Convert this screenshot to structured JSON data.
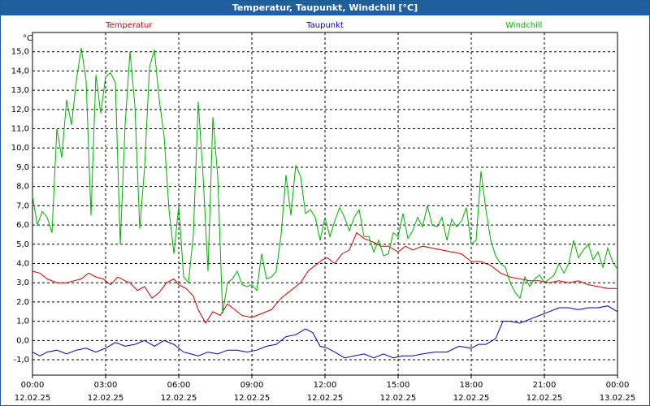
{
  "window": {
    "title": "Temperatur, Taupunkt, Windchill [°C]"
  },
  "chart_data": {
    "type": "line",
    "title": "Temperatur, Taupunkt, Windchill [°C]",
    "ylabel": "°C",
    "ylim": [
      -1.8,
      16.0
    ],
    "xlim": [
      0,
      24
    ],
    "y_ticks": [
      -1.0,
      0.0,
      1.0,
      2.0,
      3.0,
      4.0,
      5.0,
      6.0,
      7.0,
      8.0,
      9.0,
      10.0,
      11.0,
      12.0,
      13.0,
      14.0,
      15.0
    ],
    "y_tick_labels": [
      "-1,0",
      "0,0",
      "1,0",
      "2,0",
      "3,0",
      "4,0",
      "5,0",
      "6,0",
      "7,0",
      "8,0",
      "9,0",
      "10,0",
      "11,0",
      "12,0",
      "13,0",
      "14,0",
      "15,0"
    ],
    "x_ticks": [
      {
        "value": 0,
        "time": "00:00",
        "date": "12.02.25"
      },
      {
        "value": 3,
        "time": "03:00",
        "date": "12.02.25"
      },
      {
        "value": 6,
        "time": "06:00",
        "date": "12.02.25"
      },
      {
        "value": 9,
        "time": "09:00",
        "date": "12.02.25"
      },
      {
        "value": 12,
        "time": "12:00",
        "date": "12.02.25"
      },
      {
        "value": 15,
        "time": "15:00",
        "date": "12.02.25"
      },
      {
        "value": 18,
        "time": "18:00",
        "date": "12.02.25"
      },
      {
        "value": 21,
        "time": "21:00",
        "date": "12.02.25"
      },
      {
        "value": 24,
        "time": "00:00",
        "date": "13.02.25"
      }
    ],
    "grid": true,
    "legend": "top",
    "series": [
      {
        "name": "Temperatur",
        "color": "#d00000",
        "x": [
          0,
          0.3,
          0.6,
          1.0,
          1.4,
          1.7,
          2.0,
          2.3,
          2.6,
          2.9,
          3.2,
          3.5,
          3.8,
          4.0,
          4.3,
          4.6,
          4.9,
          5.2,
          5.5,
          5.8,
          6.0,
          6.3,
          6.6,
          6.8,
          7.1,
          7.4,
          7.7,
          8.0,
          8.3,
          8.6,
          9.0,
          9.4,
          9.8,
          10.2,
          10.6,
          11.0,
          11.3,
          11.6,
          11.9,
          12.1,
          12.4,
          12.7,
          13.0,
          13.3,
          13.6,
          14.0,
          14.3,
          14.6,
          15.0,
          15.3,
          15.6,
          16.0,
          16.4,
          16.8,
          17.2,
          17.6,
          18.0,
          18.4,
          18.8,
          19.2,
          19.6,
          20.0,
          20.4,
          20.8,
          21.2,
          21.6,
          22.0,
          22.4,
          22.8,
          23.2,
          23.6,
          24.0
        ],
        "y": [
          3.6,
          3.5,
          3.2,
          3.0,
          3.0,
          3.1,
          3.2,
          3.5,
          3.3,
          3.2,
          2.9,
          3.3,
          3.1,
          3.0,
          2.6,
          2.8,
          2.2,
          2.5,
          3.0,
          3.2,
          2.9,
          2.7,
          2.3,
          1.6,
          0.9,
          1.5,
          1.3,
          1.9,
          1.6,
          1.3,
          1.2,
          1.4,
          1.6,
          2.2,
          2.6,
          3.0,
          3.6,
          3.9,
          4.2,
          4.3,
          4.0,
          4.5,
          4.7,
          5.6,
          5.3,
          5.1,
          4.9,
          4.9,
          4.6,
          4.9,
          4.7,
          4.9,
          4.8,
          4.7,
          4.6,
          4.5,
          4.1,
          4.1,
          3.9,
          3.5,
          3.3,
          3.2,
          3.1,
          3.1,
          3.0,
          3.1,
          3.0,
          3.1,
          2.9,
          2.8,
          2.7,
          2.7
        ]
      },
      {
        "name": "Taupunkt",
        "color": "#0000c0",
        "x": [
          0,
          0.3,
          0.6,
          1.0,
          1.4,
          1.8,
          2.2,
          2.6,
          3.0,
          3.4,
          3.8,
          4.2,
          4.6,
          5.0,
          5.4,
          5.8,
          6.2,
          6.5,
          6.8,
          7.2,
          7.6,
          8.0,
          8.4,
          8.8,
          9.2,
          9.6,
          10.0,
          10.4,
          10.8,
          11.2,
          11.5,
          11.8,
          12.1,
          12.4,
          12.8,
          13.2,
          13.6,
          14.0,
          14.4,
          14.8,
          15.2,
          15.6,
          16.0,
          16.5,
          17.0,
          17.5,
          18.0,
          18.3,
          18.6,
          19.0,
          19.3,
          19.6,
          20.0,
          20.4,
          20.8,
          21.2,
          21.6,
          22.0,
          22.4,
          22.8,
          23.2,
          23.6,
          24.0
        ],
        "y": [
          -0.6,
          -0.8,
          -0.6,
          -0.5,
          -0.7,
          -0.5,
          -0.4,
          -0.6,
          -0.4,
          -0.1,
          -0.3,
          -0.2,
          0.0,
          -0.3,
          0.0,
          -0.2,
          -0.6,
          -0.7,
          -0.8,
          -0.6,
          -0.7,
          -0.5,
          -0.5,
          -0.6,
          -0.5,
          -0.3,
          -0.2,
          0.2,
          0.3,
          0.6,
          0.4,
          -0.3,
          -0.4,
          -0.6,
          -0.9,
          -0.8,
          -0.7,
          -0.9,
          -0.7,
          -0.9,
          -0.8,
          -0.8,
          -0.7,
          -0.6,
          -0.6,
          -0.3,
          -0.4,
          -0.2,
          -0.2,
          0.1,
          1.0,
          1.0,
          0.9,
          1.1,
          1.3,
          1.5,
          1.7,
          1.7,
          1.6,
          1.7,
          1.7,
          1.8,
          1.5
        ]
      },
      {
        "name": "Windchill",
        "color": "#00b000",
        "x": [
          0,
          0.2,
          0.4,
          0.6,
          0.8,
          1.0,
          1.2,
          1.4,
          1.6,
          1.8,
          2.0,
          2.2,
          2.4,
          2.6,
          2.8,
          3.0,
          3.2,
          3.4,
          3.6,
          3.8,
          4.0,
          4.2,
          4.4,
          4.6,
          4.8,
          5.0,
          5.2,
          5.4,
          5.6,
          5.8,
          6.0,
          6.2,
          6.4,
          6.6,
          6.8,
          7.0,
          7.2,
          7.4,
          7.6,
          7.8,
          8.0,
          8.2,
          8.4,
          8.6,
          8.8,
          9.0,
          9.2,
          9.4,
          9.6,
          9.8,
          10.0,
          10.2,
          10.4,
          10.6,
          10.8,
          11.0,
          11.2,
          11.4,
          11.6,
          11.8,
          12.0,
          12.2,
          12.4,
          12.6,
          12.8,
          13.0,
          13.2,
          13.4,
          13.6,
          13.8,
          14.0,
          14.2,
          14.4,
          14.6,
          14.8,
          15.0,
          15.2,
          15.4,
          15.6,
          15.8,
          16.0,
          16.2,
          16.4,
          16.6,
          16.8,
          17.0,
          17.2,
          17.4,
          17.6,
          17.8,
          18.0,
          18.2,
          18.4,
          18.6,
          18.8,
          19.0,
          19.2,
          19.4,
          19.6,
          19.8,
          20.0,
          20.2,
          20.4,
          20.6,
          20.8,
          21.0,
          21.2,
          21.4,
          21.6,
          21.8,
          22.0,
          22.2,
          22.4,
          22.6,
          22.8,
          23.0,
          23.2,
          23.4,
          23.6,
          23.8,
          24.0
        ],
        "y": [
          7.5,
          6.0,
          6.7,
          6.4,
          5.6,
          11.0,
          9.5,
          12.5,
          11.2,
          13.5,
          15.2,
          13.5,
          6.5,
          13.8,
          11.8,
          13.7,
          13.9,
          13.4,
          5.0,
          11.2,
          15.0,
          12.2,
          5.8,
          9.0,
          14.2,
          15.1,
          12.5,
          10.6,
          6.8,
          4.5,
          7.0,
          3.3,
          3.0,
          5.5,
          12.4,
          8.5,
          3.6,
          11.6,
          8.5,
          1.4,
          3.0,
          3.2,
          3.6,
          2.9,
          2.8,
          2.9,
          2.6,
          4.5,
          3.2,
          3.3,
          3.6,
          5.5,
          8.6,
          6.5,
          9.1,
          8.5,
          6.6,
          6.8,
          6.4,
          5.2,
          6.4,
          5.4,
          6.2,
          6.9,
          6.4,
          5.7,
          6.4,
          6.8,
          5.4,
          5.4,
          4.6,
          5.2,
          4.4,
          4.5,
          5.6,
          5.4,
          6.6,
          5.3,
          5.7,
          6.4,
          5.9,
          7.0,
          6.0,
          5.9,
          6.4,
          5.2,
          6.3,
          5.9,
          6.2,
          6.9,
          5.0,
          5.2,
          8.8,
          6.8,
          5.2,
          4.4,
          4.0,
          3.8,
          3.0,
          2.5,
          2.2,
          3.3,
          2.8,
          3.2,
          3.4,
          3.0,
          3.2,
          3.4,
          4.0,
          3.5,
          4.0,
          5.2,
          4.3,
          4.7,
          5.0,
          4.2,
          4.6,
          3.8,
          4.8,
          4.1,
          3.7
        ]
      }
    ]
  }
}
